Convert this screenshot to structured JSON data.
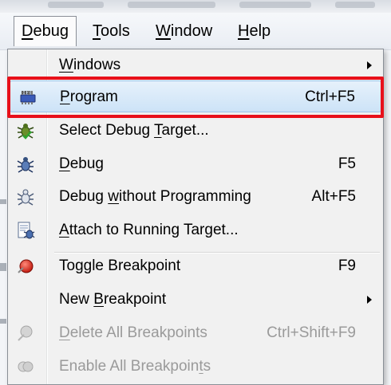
{
  "menubar": {
    "items": [
      {
        "pre": "",
        "acc": "D",
        "post": "ebug"
      },
      {
        "pre": "",
        "acc": "T",
        "post": "ools"
      },
      {
        "pre": "",
        "acc": "W",
        "post": "indow"
      },
      {
        "pre": "",
        "acc": "H",
        "post": "elp"
      }
    ]
  },
  "menu": {
    "items": [
      {
        "pre": "",
        "acc": "W",
        "post": "indows",
        "shortcut": "",
        "submenu": true,
        "icon": ""
      },
      {
        "pre": "",
        "acc": "P",
        "post": "rogram",
        "shortcut": "Ctrl+F5",
        "submenu": false,
        "icon": "program-chip-icon",
        "highlighted": true
      },
      {
        "pre": "Select Debug ",
        "acc": "T",
        "post": "arget...",
        "shortcut": "",
        "submenu": false,
        "icon": "select-debug-target-icon"
      },
      {
        "pre": "",
        "acc": "D",
        "post": "ebug",
        "shortcut": "F5",
        "submenu": false,
        "icon": "debug-bug-icon"
      },
      {
        "pre": "Debug ",
        "acc": "w",
        "post": "ithout Programming",
        "shortcut": "Alt+F5",
        "submenu": false,
        "icon": "debug-without-programming-icon"
      },
      {
        "pre": "",
        "acc": "A",
        "post": "ttach to Running Target...",
        "shortcut": "",
        "submenu": false,
        "icon": "attach-target-icon"
      },
      {
        "pre": "Toggle Breakpoint",
        "acc": "",
        "post": "",
        "shortcut": "F9",
        "submenu": false,
        "icon": "breakpoint-icon"
      },
      {
        "pre": "New ",
        "acc": "B",
        "post": "reakpoint",
        "shortcut": "",
        "submenu": true,
        "icon": ""
      },
      {
        "pre": "",
        "acc": "D",
        "post": "elete All Breakpoints",
        "shortcut": "Ctrl+Shift+F9",
        "submenu": false,
        "icon": "delete-breakpoints-icon",
        "disabled": true
      },
      {
        "pre": "Enable All Breakpoin",
        "acc": "t",
        "post": "s",
        "shortcut": "",
        "submenu": false,
        "icon": "enable-breakpoints-icon",
        "disabled": true
      }
    ]
  },
  "colors": {
    "highlight_outline": "#e8101a",
    "highlight_fill": "#cde3f7"
  }
}
